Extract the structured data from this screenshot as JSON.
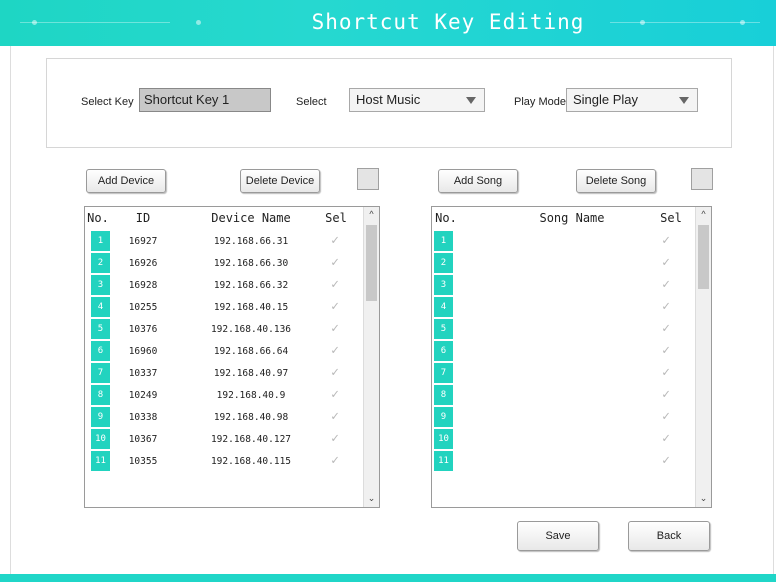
{
  "title": "Shortcut Key Editing",
  "select_key": {
    "label": "Select Key",
    "value": "Shortcut Key 1"
  },
  "select_source": {
    "label": "Select",
    "value": "Host Music"
  },
  "play_mode": {
    "label": "Play Mode",
    "value": "Single Play"
  },
  "device_panel": {
    "add_label": "Add Device",
    "delete_label": "Delete Device",
    "headers": {
      "no": "No.",
      "id": "ID",
      "name": "Device Name",
      "sel": "Sel"
    },
    "rows": [
      {
        "no": "1",
        "id": "16927",
        "name": "192.168.66.31"
      },
      {
        "no": "2",
        "id": "16926",
        "name": "192.168.66.30"
      },
      {
        "no": "3",
        "id": "16928",
        "name": "192.168.66.32"
      },
      {
        "no": "4",
        "id": "10255",
        "name": "192.168.40.15"
      },
      {
        "no": "5",
        "id": "10376",
        "name": "192.168.40.136"
      },
      {
        "no": "6",
        "id": "16960",
        "name": "192.168.66.64"
      },
      {
        "no": "7",
        "id": "10337",
        "name": "192.168.40.97"
      },
      {
        "no": "8",
        "id": "10249",
        "name": "192.168.40.9"
      },
      {
        "no": "9",
        "id": "10338",
        "name": "192.168.40.98"
      },
      {
        "no": "10",
        "id": "10367",
        "name": "192.168.40.127"
      },
      {
        "no": "11",
        "id": "10355",
        "name": "192.168.40.115"
      }
    ]
  },
  "song_panel": {
    "add_label": "Add Song",
    "delete_label": "Delete Song",
    "headers": {
      "no": "No.",
      "name": "Song Name",
      "sel": "Sel"
    },
    "rows": [
      {
        "no": "1"
      },
      {
        "no": "2"
      },
      {
        "no": "3"
      },
      {
        "no": "4"
      },
      {
        "no": "5"
      },
      {
        "no": "6"
      },
      {
        "no": "7"
      },
      {
        "no": "8"
      },
      {
        "no": "9"
      },
      {
        "no": "10"
      },
      {
        "no": "11"
      }
    ]
  },
  "save_label": "Save",
  "back_label": "Back",
  "colors": {
    "accent": "#22d3bf",
    "title_bar": "#1ed6c4"
  },
  "icons": {
    "check": "check-icon",
    "dropdown": "chevron-down-icon",
    "scroll_up": "scroll-up-icon",
    "scroll_down": "scroll-down-icon"
  }
}
